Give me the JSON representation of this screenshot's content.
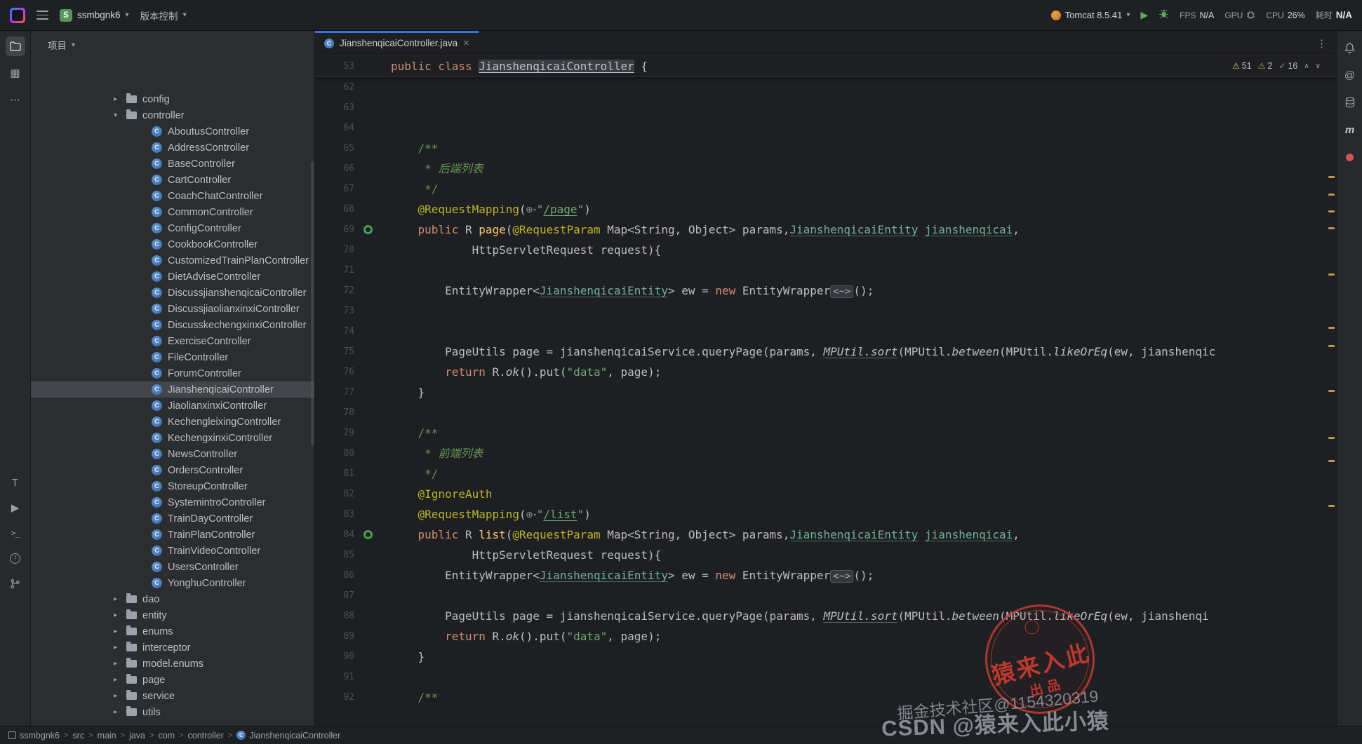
{
  "titlebar": {
    "project_name": "ssmbgnk6",
    "project_badge": "S",
    "vcs_label": "版本控制",
    "run_config": "Tomcat 8.5.41",
    "perf": {
      "fps_label": "FPS",
      "fps_value": "N/A",
      "gpu_label": "GPU",
      "cpu_label": "CPU",
      "cpu_value": "26%",
      "time_label": "耗时",
      "time_value": "N/A"
    }
  },
  "icons": {
    "chevron_down": "▾",
    "chevron_right": "▸",
    "more_v": "⋮",
    "more_h": "⋯",
    "play": "▶",
    "structure": "▦",
    "translation": "T",
    "services": "▶",
    "terminal": ">_",
    "problems": "!",
    "at": "@",
    "maven": "m",
    "close": "×",
    "globe": "⊕",
    "class_letter": "C",
    "insp_warn": "⚠",
    "insp_ok": "✓",
    "nav_up": "∧",
    "nav_down": "∨"
  },
  "project_panel": {
    "title": "项目",
    "tree": [
      {
        "label": "config",
        "kind": "pkg",
        "depth": 0,
        "chevron": "right"
      },
      {
        "label": "controller",
        "kind": "pkg",
        "depth": 0,
        "chevron": "down"
      },
      {
        "label": "AboutusController",
        "kind": "cls",
        "depth": 1
      },
      {
        "label": "AddressController",
        "kind": "cls",
        "depth": 1
      },
      {
        "label": "BaseController",
        "kind": "cls",
        "depth": 1
      },
      {
        "label": "CartController",
        "kind": "cls",
        "depth": 1
      },
      {
        "label": "CoachChatController",
        "kind": "cls",
        "depth": 1
      },
      {
        "label": "CommonController",
        "kind": "cls",
        "depth": 1
      },
      {
        "label": "ConfigController",
        "kind": "cls",
        "depth": 1
      },
      {
        "label": "CookbookController",
        "kind": "cls",
        "depth": 1
      },
      {
        "label": "CustomizedTrainPlanController",
        "kind": "cls",
        "depth": 1
      },
      {
        "label": "DietAdviseController",
        "kind": "cls",
        "depth": 1
      },
      {
        "label": "DiscussjianshenqicaiController",
        "kind": "cls",
        "depth": 1
      },
      {
        "label": "DiscussjiaolianxinxiController",
        "kind": "cls",
        "depth": 1
      },
      {
        "label": "DiscusskechengxinxiController",
        "kind": "cls",
        "depth": 1
      },
      {
        "label": "ExerciseController",
        "kind": "cls",
        "depth": 1
      },
      {
        "label": "FileController",
        "kind": "cls",
        "depth": 1
      },
      {
        "label": "ForumController",
        "kind": "cls",
        "depth": 1
      },
      {
        "label": "JianshenqicaiController",
        "kind": "cls",
        "depth": 1,
        "selected": true
      },
      {
        "label": "JiaolianxinxiController",
        "kind": "cls",
        "depth": 1
      },
      {
        "label": "KechengleixingController",
        "kind": "cls",
        "depth": 1
      },
      {
        "label": "KechengxinxiController",
        "kind": "cls",
        "depth": 1
      },
      {
        "label": "NewsController",
        "kind": "cls",
        "depth": 1
      },
      {
        "label": "OrdersController",
        "kind": "cls",
        "depth": 1
      },
      {
        "label": "StoreupController",
        "kind": "cls",
        "depth": 1
      },
      {
        "label": "SystemintroController",
        "kind": "cls",
        "depth": 1
      },
      {
        "label": "TrainDayController",
        "kind": "cls",
        "depth": 1
      },
      {
        "label": "TrainPlanController",
        "kind": "cls",
        "depth": 1
      },
      {
        "label": "TrainVideoController",
        "kind": "cls",
        "depth": 1
      },
      {
        "label": "UsersController",
        "kind": "cls",
        "depth": 1
      },
      {
        "label": "YonghuController",
        "kind": "cls",
        "depth": 1
      },
      {
        "label": "dao",
        "kind": "pkg",
        "depth": 0,
        "chevron": "right"
      },
      {
        "label": "entity",
        "kind": "pkg",
        "depth": 0,
        "chevron": "right"
      },
      {
        "label": "enums",
        "kind": "pkg",
        "depth": 0,
        "chevron": "right"
      },
      {
        "label": "interceptor",
        "kind": "pkg",
        "depth": 0,
        "chevron": "right"
      },
      {
        "label": "model.enums",
        "kind": "pkg",
        "depth": 0,
        "chevron": "right"
      },
      {
        "label": "page",
        "kind": "pkg",
        "depth": 0,
        "chevron": "right"
      },
      {
        "label": "service",
        "kind": "pkg",
        "depth": 0,
        "chevron": "right"
      },
      {
        "label": "utils",
        "kind": "pkg",
        "depth": 0,
        "chevron": "right"
      }
    ]
  },
  "editor": {
    "tab_title": "JianshenqicaiController.java",
    "inspections": {
      "warnings": "51",
      "weak_warnings": "2",
      "typos": "16"
    },
    "sticky": {
      "line": "53",
      "tokens": [
        [
          "public class ",
          "k"
        ],
        [
          "JianshenqicaiController",
          "hl"
        ],
        [
          " {",
          "d"
        ]
      ]
    },
    "lines": [
      {
        "n": "62",
        "tokens": []
      },
      {
        "n": "63",
        "tokens": []
      },
      {
        "n": "64",
        "tokens": []
      },
      {
        "n": "65",
        "tokens": [
          [
            "    /**",
            "c"
          ]
        ]
      },
      {
        "n": "66",
        "tokens": [
          [
            "     * ",
            "c"
          ],
          [
            "后端列表",
            "ci"
          ]
        ]
      },
      {
        "n": "67",
        "tokens": [
          [
            "     */",
            "c"
          ]
        ]
      },
      {
        "n": "68",
        "tokens": [
          [
            "    ",
            "d"
          ],
          [
            "@RequestMapping",
            "a"
          ],
          [
            "(",
            "d"
          ],
          [
            "",
            "g"
          ],
          [
            "\"",
            "s"
          ],
          [
            "/page",
            "su"
          ],
          [
            "\"",
            "s"
          ],
          [
            ")",
            "d"
          ]
        ]
      },
      {
        "n": "69",
        "marker": true,
        "tokens": [
          [
            "    ",
            "d"
          ],
          [
            "public ",
            "k"
          ],
          [
            "R ",
            "d"
          ],
          [
            "page",
            "m"
          ],
          [
            "(",
            "d"
          ],
          [
            "@RequestParam",
            "a"
          ],
          [
            " Map<String, Object> params,",
            "d"
          ],
          [
            "JianshenqicaiEntity",
            "t"
          ],
          [
            " ",
            "d"
          ],
          [
            "jianshenqicai",
            "t"
          ],
          [
            ",",
            "d"
          ]
        ]
      },
      {
        "n": "70",
        "tokens": [
          [
            "            HttpServletRequest request){",
            "d"
          ]
        ]
      },
      {
        "n": "71",
        "tokens": []
      },
      {
        "n": "72",
        "tokens": [
          [
            "        EntityWrapper<",
            "d"
          ],
          [
            "JianshenqicaiEntity",
            "t"
          ],
          [
            "> ew = ",
            "d"
          ],
          [
            "new ",
            "k"
          ],
          [
            "EntityWrapper",
            "d"
          ],
          [
            "<~>",
            "f"
          ],
          [
            "();",
            "d"
          ]
        ]
      },
      {
        "n": "73",
        "tokens": []
      },
      {
        "n": "74",
        "tokens": []
      },
      {
        "n": "75",
        "tokens": [
          [
            "        PageUtils page = ",
            "d"
          ],
          [
            "jianshenqicaiService",
            "d"
          ],
          [
            ".queryPage(params, ",
            "d"
          ],
          [
            "MPUtil.sort",
            "iu"
          ],
          [
            "(MPUtil.",
            "d"
          ],
          [
            "between",
            "i"
          ],
          [
            "(MPUtil.",
            "d"
          ],
          [
            "likeOrEq",
            "i"
          ],
          [
            "(ew, jianshenqic",
            "d"
          ]
        ]
      },
      {
        "n": "76",
        "tokens": [
          [
            "        ",
            "d"
          ],
          [
            "return ",
            "k"
          ],
          [
            "R.",
            "d"
          ],
          [
            "ok",
            "i"
          ],
          [
            "().put(",
            "d"
          ],
          [
            "\"data\"",
            "s"
          ],
          [
            ", page);",
            "d"
          ]
        ]
      },
      {
        "n": "77",
        "tokens": [
          [
            "    }",
            "d"
          ]
        ]
      },
      {
        "n": "78",
        "tokens": []
      },
      {
        "n": "79",
        "tokens": [
          [
            "    /**",
            "c"
          ]
        ]
      },
      {
        "n": "80",
        "tokens": [
          [
            "     * ",
            "c"
          ],
          [
            "前端列表",
            "ci"
          ]
        ]
      },
      {
        "n": "81",
        "tokens": [
          [
            "     */",
            "c"
          ]
        ]
      },
      {
        "n": "82",
        "tokens": [
          [
            "    ",
            "d"
          ],
          [
            "@IgnoreAuth",
            "a"
          ]
        ]
      },
      {
        "n": "83",
        "tokens": [
          [
            "    ",
            "d"
          ],
          [
            "@RequestMapping",
            "a"
          ],
          [
            "(",
            "d"
          ],
          [
            "",
            "g"
          ],
          [
            "\"",
            "s"
          ],
          [
            "/list",
            "su"
          ],
          [
            "\"",
            "s"
          ],
          [
            ")",
            "d"
          ]
        ]
      },
      {
        "n": "84",
        "marker": true,
        "tokens": [
          [
            "    ",
            "d"
          ],
          [
            "public ",
            "k"
          ],
          [
            "R ",
            "d"
          ],
          [
            "list",
            "m"
          ],
          [
            "(",
            "d"
          ],
          [
            "@RequestParam",
            "a"
          ],
          [
            " Map<String, Object> params,",
            "d"
          ],
          [
            "JianshenqicaiEntity",
            "t"
          ],
          [
            " ",
            "d"
          ],
          [
            "jianshenqicai",
            "t"
          ],
          [
            ",",
            "d"
          ]
        ]
      },
      {
        "n": "85",
        "tokens": [
          [
            "            HttpServletRequest request){",
            "d"
          ]
        ]
      },
      {
        "n": "86",
        "tokens": [
          [
            "        EntityWrapper<",
            "d"
          ],
          [
            "JianshenqicaiEntity",
            "t"
          ],
          [
            "> ew = ",
            "d"
          ],
          [
            "new ",
            "k"
          ],
          [
            "EntityWrapper",
            "d"
          ],
          [
            "<~>",
            "f"
          ],
          [
            "();",
            "d"
          ]
        ]
      },
      {
        "n": "87",
        "tokens": []
      },
      {
        "n": "88",
        "tokens": [
          [
            "        PageUtils page = ",
            "d"
          ],
          [
            "jianshenqicaiService",
            "d"
          ],
          [
            ".queryPage(params, ",
            "d"
          ],
          [
            "MPUtil.sort",
            "iu"
          ],
          [
            "(MPUtil.",
            "d"
          ],
          [
            "between",
            "i"
          ],
          [
            "(MPUtil.",
            "d"
          ],
          [
            "likeOrEq",
            "i"
          ],
          [
            "(ew, jianshenqi",
            "d"
          ]
        ]
      },
      {
        "n": "89",
        "tokens": [
          [
            "        ",
            "d"
          ],
          [
            "return ",
            "k"
          ],
          [
            "R.",
            "d"
          ],
          [
            "ok",
            "i"
          ],
          [
            "().put(",
            "d"
          ],
          [
            "\"data\"",
            "s"
          ],
          [
            ", page);",
            "d"
          ]
        ]
      },
      {
        "n": "90",
        "tokens": [
          [
            "    }",
            "d"
          ]
        ]
      },
      {
        "n": "91",
        "tokens": []
      },
      {
        "n": "92",
        "tokens": [
          [
            "    /**",
            "c"
          ]
        ]
      }
    ],
    "stripe_marks": [
      171,
      196,
      220,
      244,
      310,
      386,
      412,
      476,
      543,
      576,
      640
    ]
  },
  "status_bar": {
    "breadcrumbs": [
      "ssmbgnk6",
      "src",
      "main",
      "java",
      "com",
      "controller",
      "JianshenqicaiController"
    ]
  },
  "watermarks": {
    "stamp_title": "猿来入此",
    "stamp_sub": "出品",
    "juejin": "掘金技术社区@1154320319",
    "csdn": "CSDN @猿来入此小猿"
  },
  "colors": {
    "accent": "#3574F0",
    "warning": "#F2C55C",
    "run_green": "#5FAD65",
    "stamp_red": "#C5443A"
  }
}
